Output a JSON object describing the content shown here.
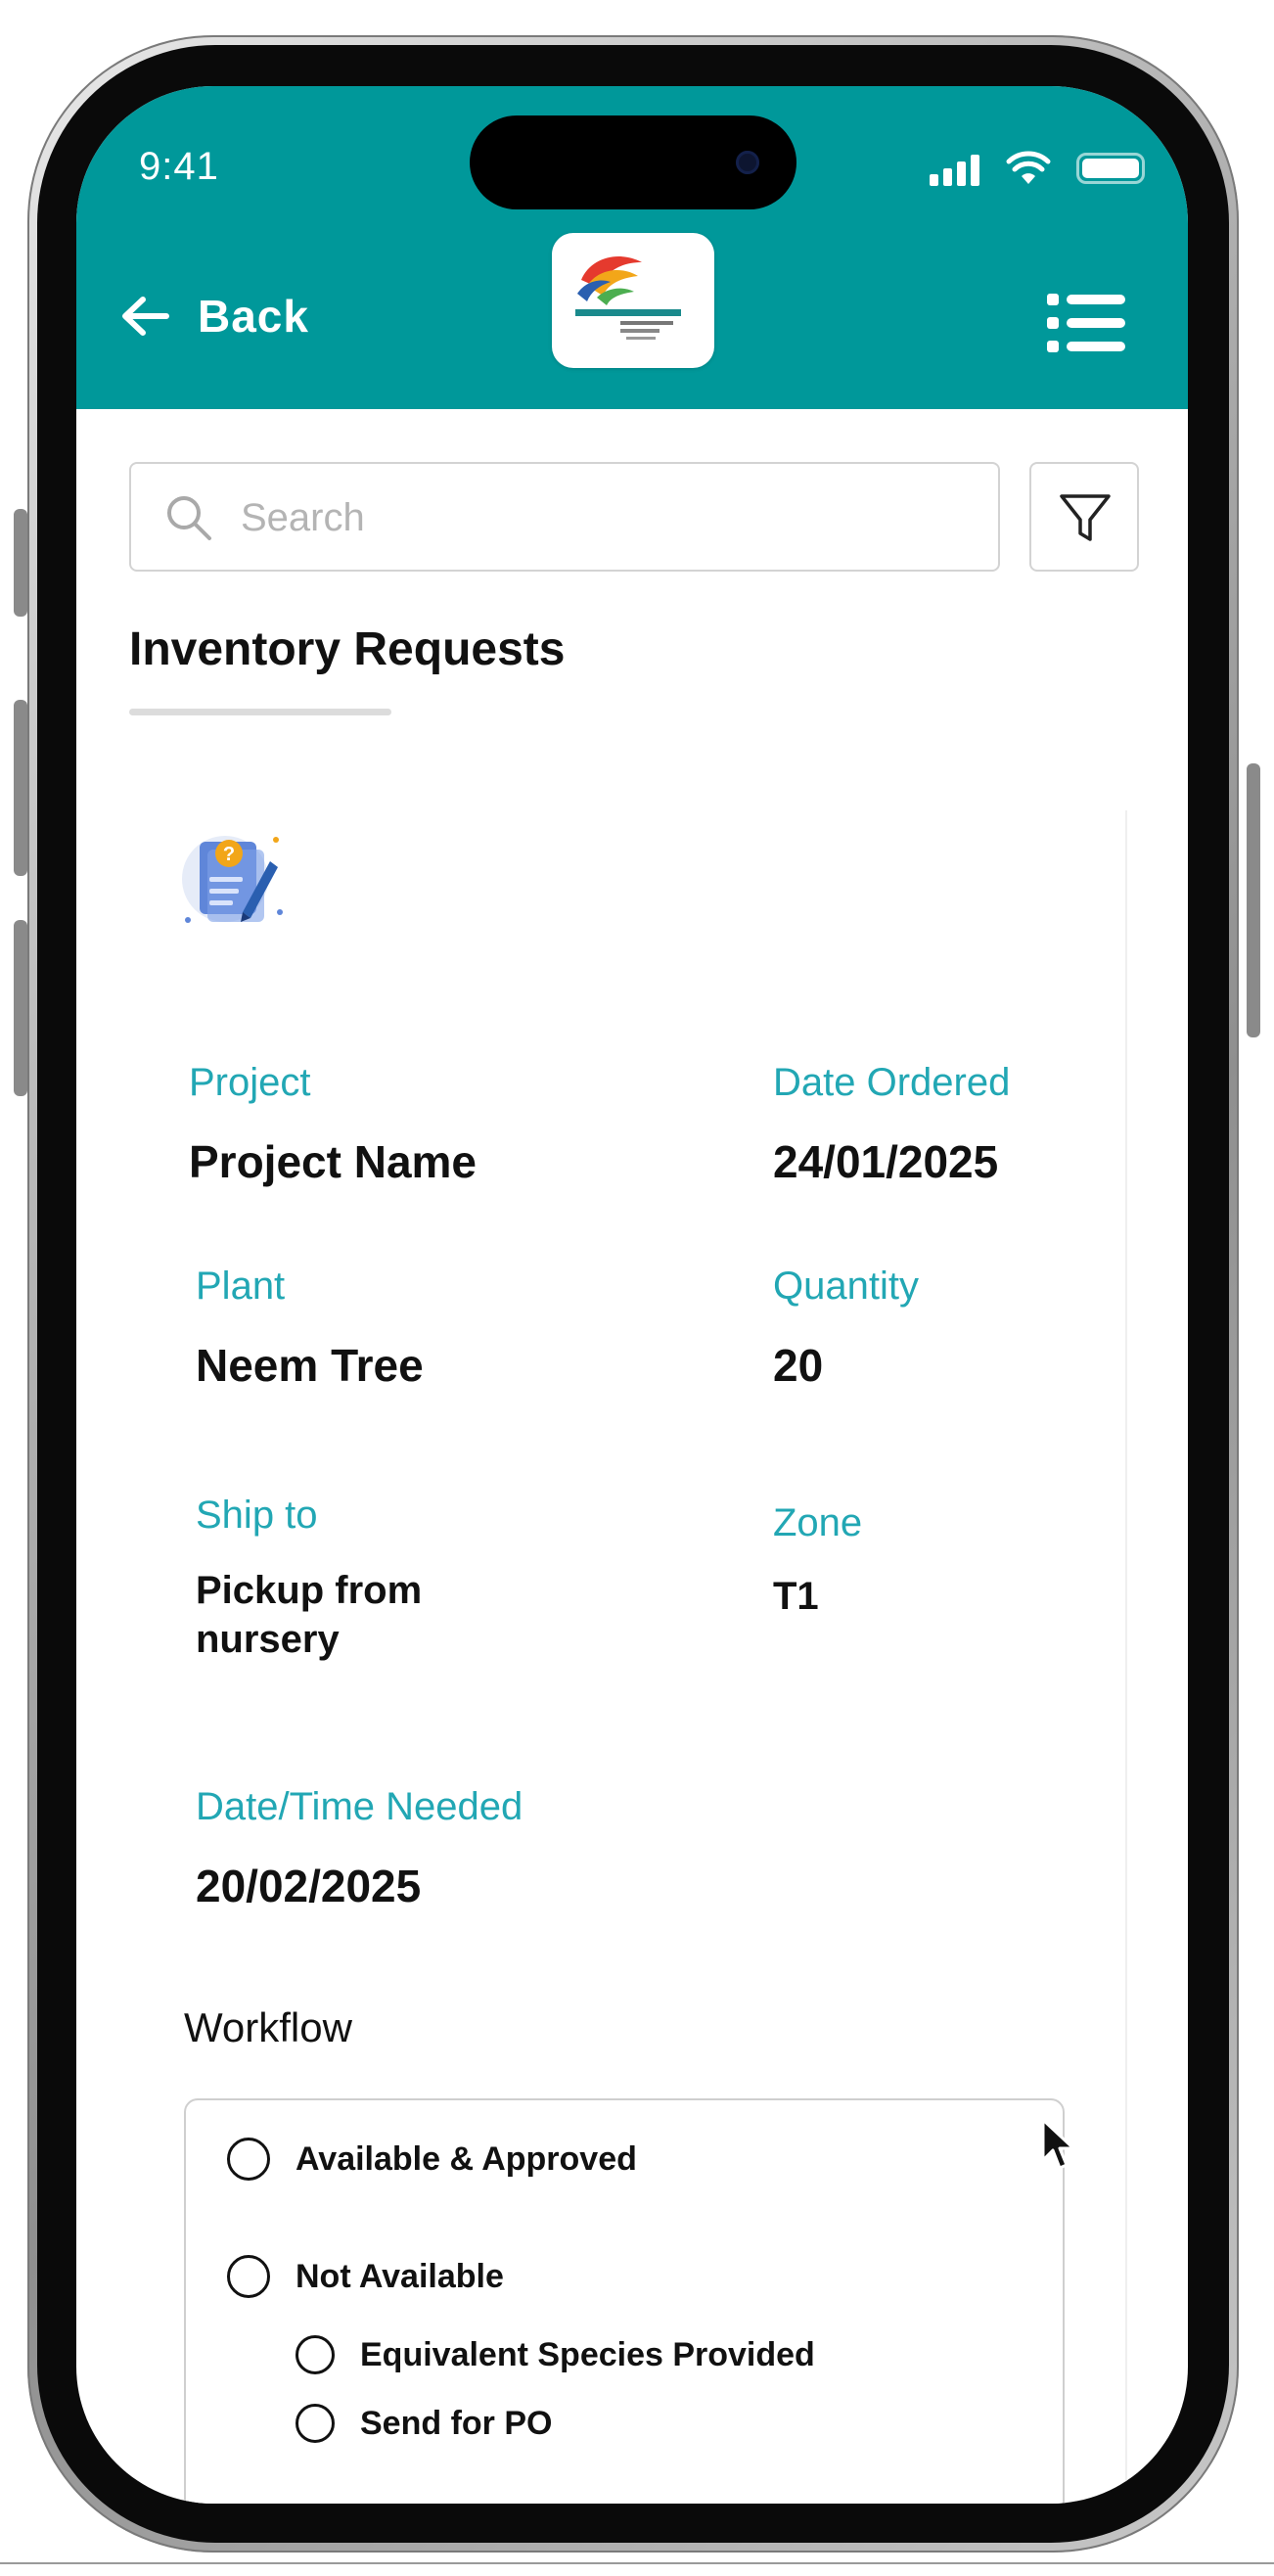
{
  "status_bar": {
    "time": "9:41"
  },
  "header": {
    "back_label": "Back"
  },
  "search": {
    "placeholder": "Search"
  },
  "page": {
    "title": "Inventory Requests"
  },
  "request": {
    "project_label": "Project",
    "project_value": "Project Name",
    "date_ordered_label": "Date Ordered",
    "date_ordered_value": "24/01/2025",
    "plant_label": "Plant",
    "plant_value": "Neem Tree",
    "quantity_label": "Quantity",
    "quantity_value": "20",
    "ship_to_label": "Ship to",
    "ship_to_value_line1": "Pickup from",
    "ship_to_value_line2": "nursery",
    "zone_label": "Zone",
    "zone_value": "T1",
    "date_needed_label": "Date/Time Needed",
    "date_needed_value": "20/02/2025"
  },
  "workflow": {
    "title": "Workflow",
    "options": [
      {
        "label": "Available & Approved"
      },
      {
        "label": "Not Available"
      },
      {
        "label": "Equivalent Species Provided"
      },
      {
        "label": "Send for PO"
      }
    ]
  },
  "colors": {
    "header": "#00989a",
    "label_accent": "#22a7b4"
  },
  "icons": [
    "back-arrow-icon",
    "list-menu-icon",
    "search-icon",
    "filter-icon",
    "request-document-icon",
    "mouse-cursor-icon"
  ]
}
